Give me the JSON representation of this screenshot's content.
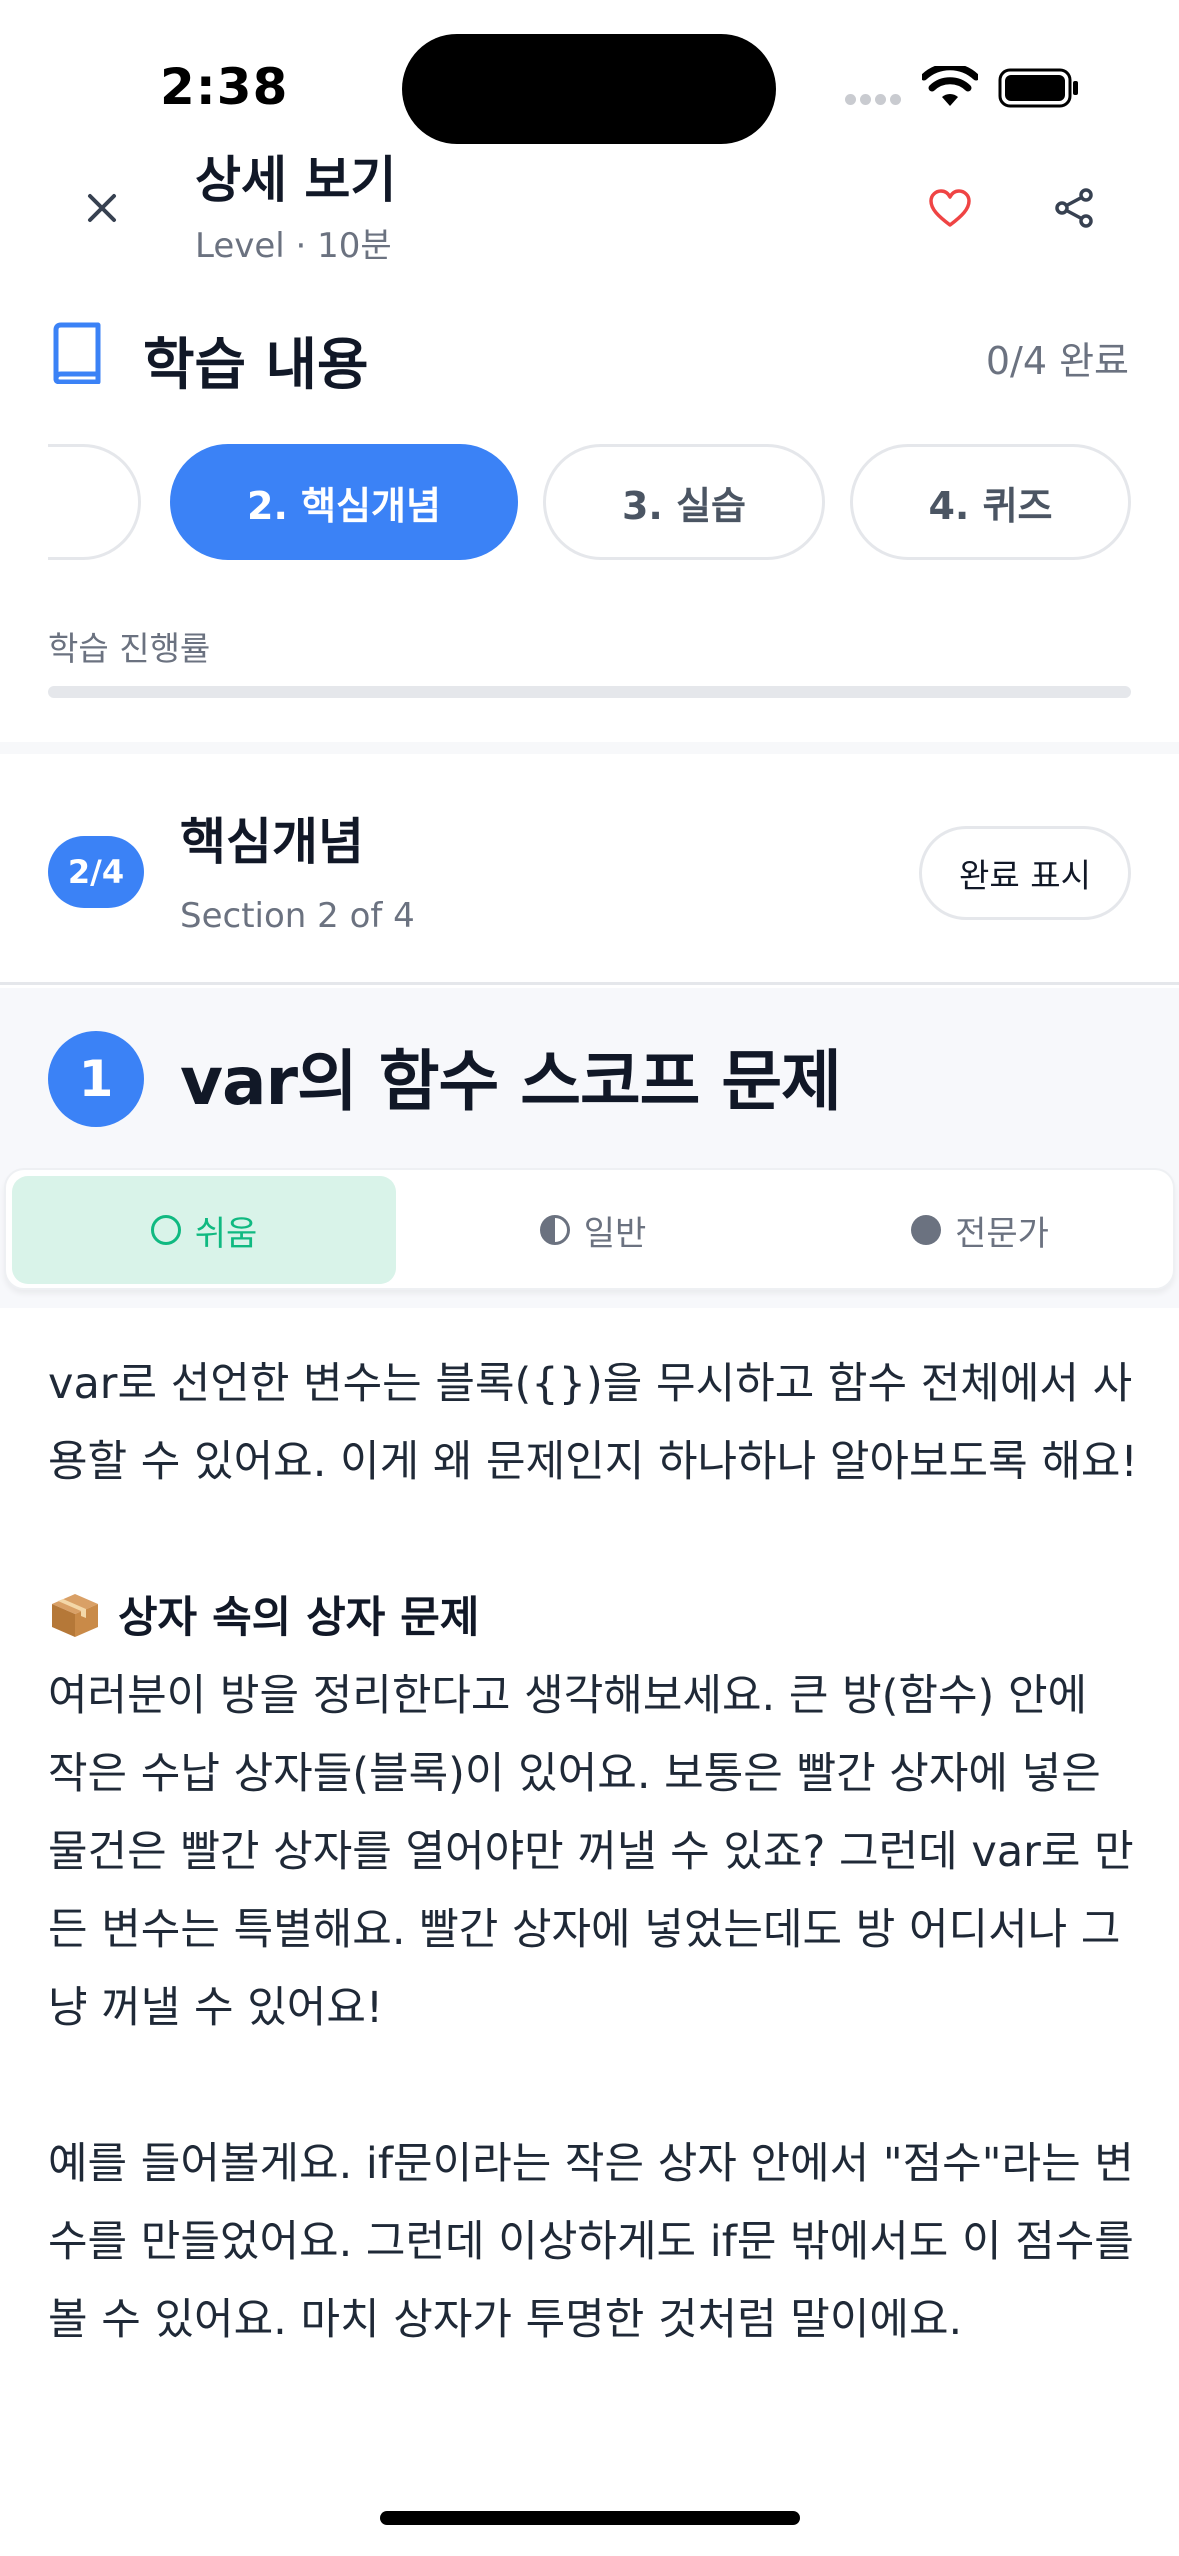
{
  "status_bar": {
    "time": "2:38"
  },
  "header": {
    "title": "상세 보기",
    "subtitle": "Level  · 10분"
  },
  "learning": {
    "title": "학습 내용",
    "completed": "0/4 완료",
    "tabs": [
      {
        "label": ""
      },
      {
        "label": "2.  핵심개념"
      },
      {
        "label": "3.  실습"
      },
      {
        "label": "4.  퀴즈"
      }
    ],
    "progress_label": "학습 진행률",
    "progress_fraction": 0
  },
  "section": {
    "badge": "2/4",
    "title": "핵심개념",
    "subtitle": "Section 2 of 4",
    "complete_button": "완료 표시"
  },
  "topic": {
    "number": "1",
    "title": "var의 함수 스코프 문제"
  },
  "levels": [
    {
      "label": "쉬움",
      "active": true
    },
    {
      "label": "일반",
      "active": false
    },
    {
      "label": "전문가",
      "active": false
    }
  ],
  "content": {
    "intro": "var로 선언한 변수는 블록({})을 무시하고 함수 전체에서 사용할 수 있어요. 이게 왜 문제인지 하나하나 알아보도록 해요!",
    "subheading": "상자 속의 상자 문제",
    "paragraph1": "여러분이 방을 정리한다고 생각해보세요. 큰 방(함수) 안에 작은 수납 상자들(블록)이 있어요. 보통은 빨간 상자에 넣은 물건은 빨간 상자를 열어야만 꺼낼 수 있죠? 그런데 var로 만든 변수는 특별해요. 빨간 상자에 넣었는데도 방 어디서나 그냥 꺼낼 수 있어요!",
    "paragraph2": "예를 들어볼게요. if문이라는 작은 상자 안에서 \"점수\"라는 변수를 만들었어요. 그런데 이상하게도 if문 밖에서도 이 점수를 볼 수 있어요. 마치 상자가 투명한 것처럼 말이에요."
  },
  "colors": {
    "accent": "#3b82f6",
    "heart": "#ef4444",
    "easy_green": "#10b981",
    "easy_bg": "#d9f3e9"
  }
}
